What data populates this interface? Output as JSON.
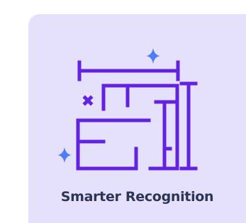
{
  "card": {
    "title": "Smarter Recognition",
    "icon": "floor-plan-measure-icon",
    "colors": {
      "background": "#e5e1fb",
      "icon_stroke": "#6222e0",
      "sparkle": "#4f7df5",
      "title_text": "#2d3557"
    }
  }
}
